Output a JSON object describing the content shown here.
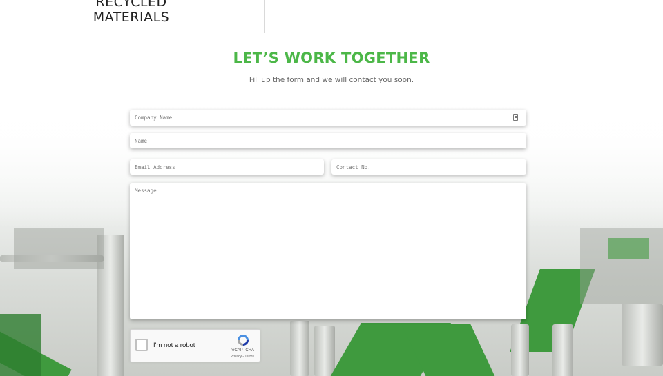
{
  "header": {
    "brand_line1": "RECYCLED",
    "brand_line2": "MATERIALS"
  },
  "contact": {
    "heading": "LET’S WORK TOGETHER",
    "subheading": "Fill up the form and we will contact you soon.",
    "fields": {
      "company_placeholder": "Company Name",
      "name_placeholder": "Name",
      "email_placeholder": "Email Address",
      "contact_placeholder": "Contact No.",
      "message_placeholder": "Message"
    }
  },
  "recaptcha": {
    "label": "I'm not a robot",
    "brand": "reCAPTCHA",
    "links": "Privacy - Terms",
    "logo_icon": "recaptcha-logo-icon"
  },
  "colors": {
    "accent_green": "#4cb748"
  }
}
